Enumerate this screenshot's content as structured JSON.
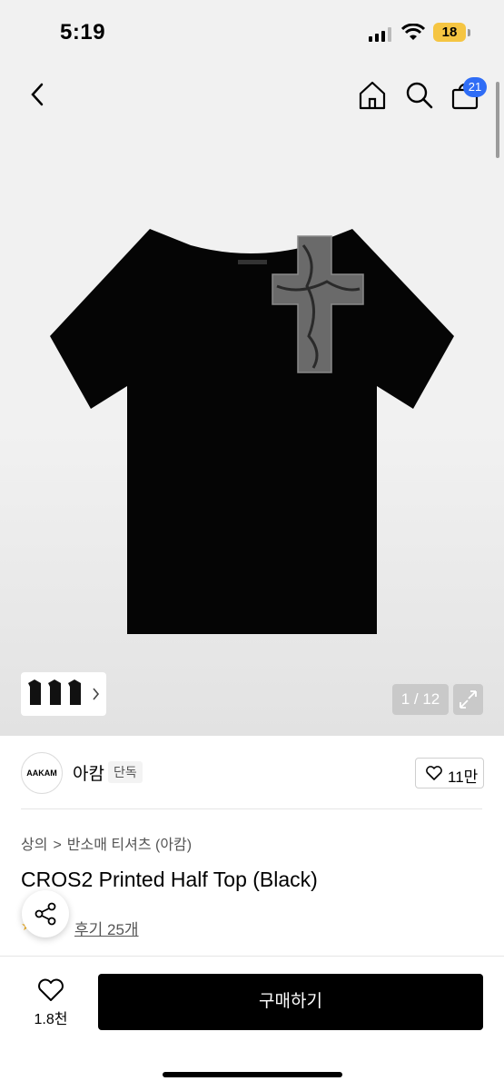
{
  "status": {
    "time": "5:19",
    "battery": "18"
  },
  "nav": {
    "cart_count": "21"
  },
  "gallery": {
    "counter": "1 / 12"
  },
  "brand": {
    "logo_text": "AAKAM",
    "name": "아캄",
    "tag": "단독",
    "likes": "11만"
  },
  "breadcrumb": {
    "level1": "상의",
    "separator": ">",
    "level2": "반소매 티셔츠 (아캄)"
  },
  "product": {
    "title": "CROS2 Printed Half Top (Black)",
    "review_text": "후기 25개"
  },
  "bottom": {
    "wish_count": "1.8천",
    "buy_label": "구매하기"
  },
  "colors": {
    "accent_badge": "#2f6df6",
    "buy_button": "#000000"
  },
  "icons": [
    "back-icon",
    "home-icon",
    "search-icon",
    "cart-icon",
    "heart-icon",
    "share-icon",
    "expand-icon",
    "chevron-right-icon"
  ]
}
